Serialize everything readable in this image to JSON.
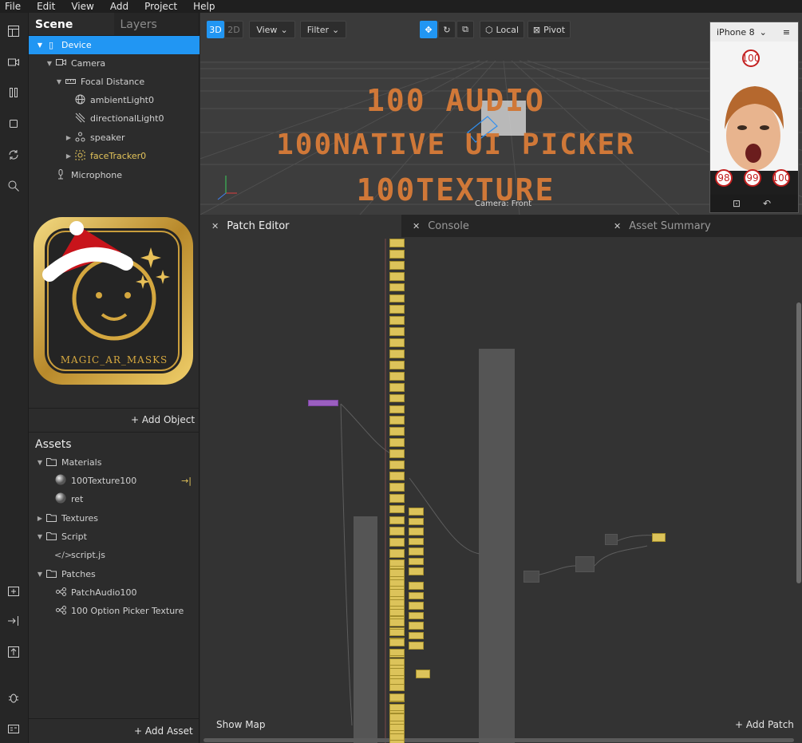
{
  "menu": [
    "File",
    "Edit",
    "View",
    "Add",
    "Project",
    "Help"
  ],
  "tools": [
    "layout-icon",
    "video-icon",
    "pause-icon",
    "square-icon",
    "sync-icon",
    "search-icon",
    "add-asset-icon",
    "import-icon",
    "export-icon",
    "bug-icon",
    "panel-icon"
  ],
  "scene": {
    "tabs": [
      "Scene",
      "Layers"
    ],
    "tree": [
      {
        "label": "Device",
        "icon": "phone-icon"
      },
      {
        "label": "Camera",
        "icon": "camera-icon"
      },
      {
        "label": "Focal Distance",
        "icon": "focal-icon"
      },
      {
        "label": "ambientLight0",
        "icon": "globe-icon"
      },
      {
        "label": "directionalLight0",
        "icon": "light-icon"
      },
      {
        "label": "speaker",
        "icon": "speaker-icon"
      },
      {
        "label": "faceTracker0",
        "icon": "face-tracker-icon"
      },
      {
        "label": "Microphone",
        "icon": "microphone-icon"
      }
    ],
    "logo_text": "MAGIC_AR_MASKS",
    "add_object": "Add Object"
  },
  "assets": {
    "title": "Assets",
    "tree": [
      {
        "label": "Materials",
        "icon": "folder-icon"
      },
      {
        "label": "100Texture100",
        "icon": "material-sphere-icon"
      },
      {
        "label": "ret",
        "icon": "material-sphere-icon"
      },
      {
        "label": "Textures",
        "icon": "folder-icon"
      },
      {
        "label": "Script",
        "icon": "folder-icon"
      },
      {
        "label": "script.js",
        "icon": "code-icon"
      },
      {
        "label": "Patches",
        "icon": "folder-icon"
      },
      {
        "label": "PatchAudio100",
        "icon": "patch-icon"
      },
      {
        "label": "100 Option Picker Texture",
        "icon": "patch-icon"
      }
    ],
    "add_asset": "Add Asset"
  },
  "viewport": {
    "mode_3d": "3D",
    "mode_2d": "2D",
    "view": "View",
    "filter": "Filter",
    "local": "Local",
    "pivot": "Pivot",
    "overlay": [
      "100 AUDIO",
      "100NATIVE UI PICKER",
      "100TEXTURE"
    ],
    "camera_label": "Camera: Front",
    "device": "iPhone 8",
    "scores": [
      "100",
      "98",
      "99",
      "100"
    ]
  },
  "patch": {
    "tabs": [
      "Patch Editor",
      "Console",
      "Asset Summary"
    ],
    "show_map": "Show Map",
    "add_patch": "Add Patch"
  },
  "colors": {
    "accent": "#2196f3",
    "node": "#dcc35a",
    "overlay": "#d07838",
    "purple_node": "#9b5fc0"
  }
}
